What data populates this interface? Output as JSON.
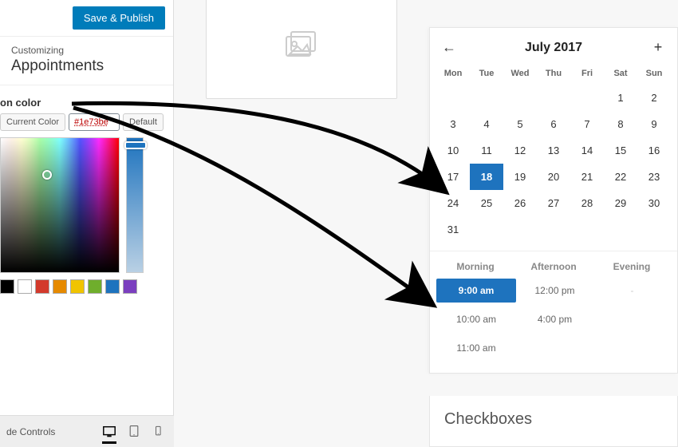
{
  "colors": {
    "accent": "#1e73be"
  },
  "sidebar": {
    "publish_label": "Save & Publish",
    "crumb": "Customizing",
    "section": "Appointments",
    "control_label": "on color",
    "current_color_btn": "Current Color",
    "hex_value": "#1e73be",
    "default_btn": "Default",
    "swatches": [
      "#000000",
      "#ffffff",
      "#d33a2c",
      "#e68a00",
      "#f0c400",
      "#6fae2c",
      "#1e73be",
      "#7b3fbf"
    ],
    "footer_label": "de Controls"
  },
  "preview": {
    "calendar": {
      "title": "July 2017",
      "dow": [
        "Mon",
        "Tue",
        "Wed",
        "Thu",
        "Fri",
        "Sat",
        "Sun"
      ],
      "leading_blanks": 5,
      "days": 31,
      "selected_day": 18
    },
    "times": {
      "headers": [
        "Morning",
        "Afternoon",
        "Evening"
      ],
      "rows": [
        [
          "9:00 am",
          "12:00 pm",
          "-"
        ],
        [
          "10:00 am",
          "4:00 pm",
          ""
        ],
        [
          "11:00 am",
          "",
          ""
        ]
      ],
      "selected": "9:00 am"
    },
    "next_section": "Checkboxes"
  }
}
